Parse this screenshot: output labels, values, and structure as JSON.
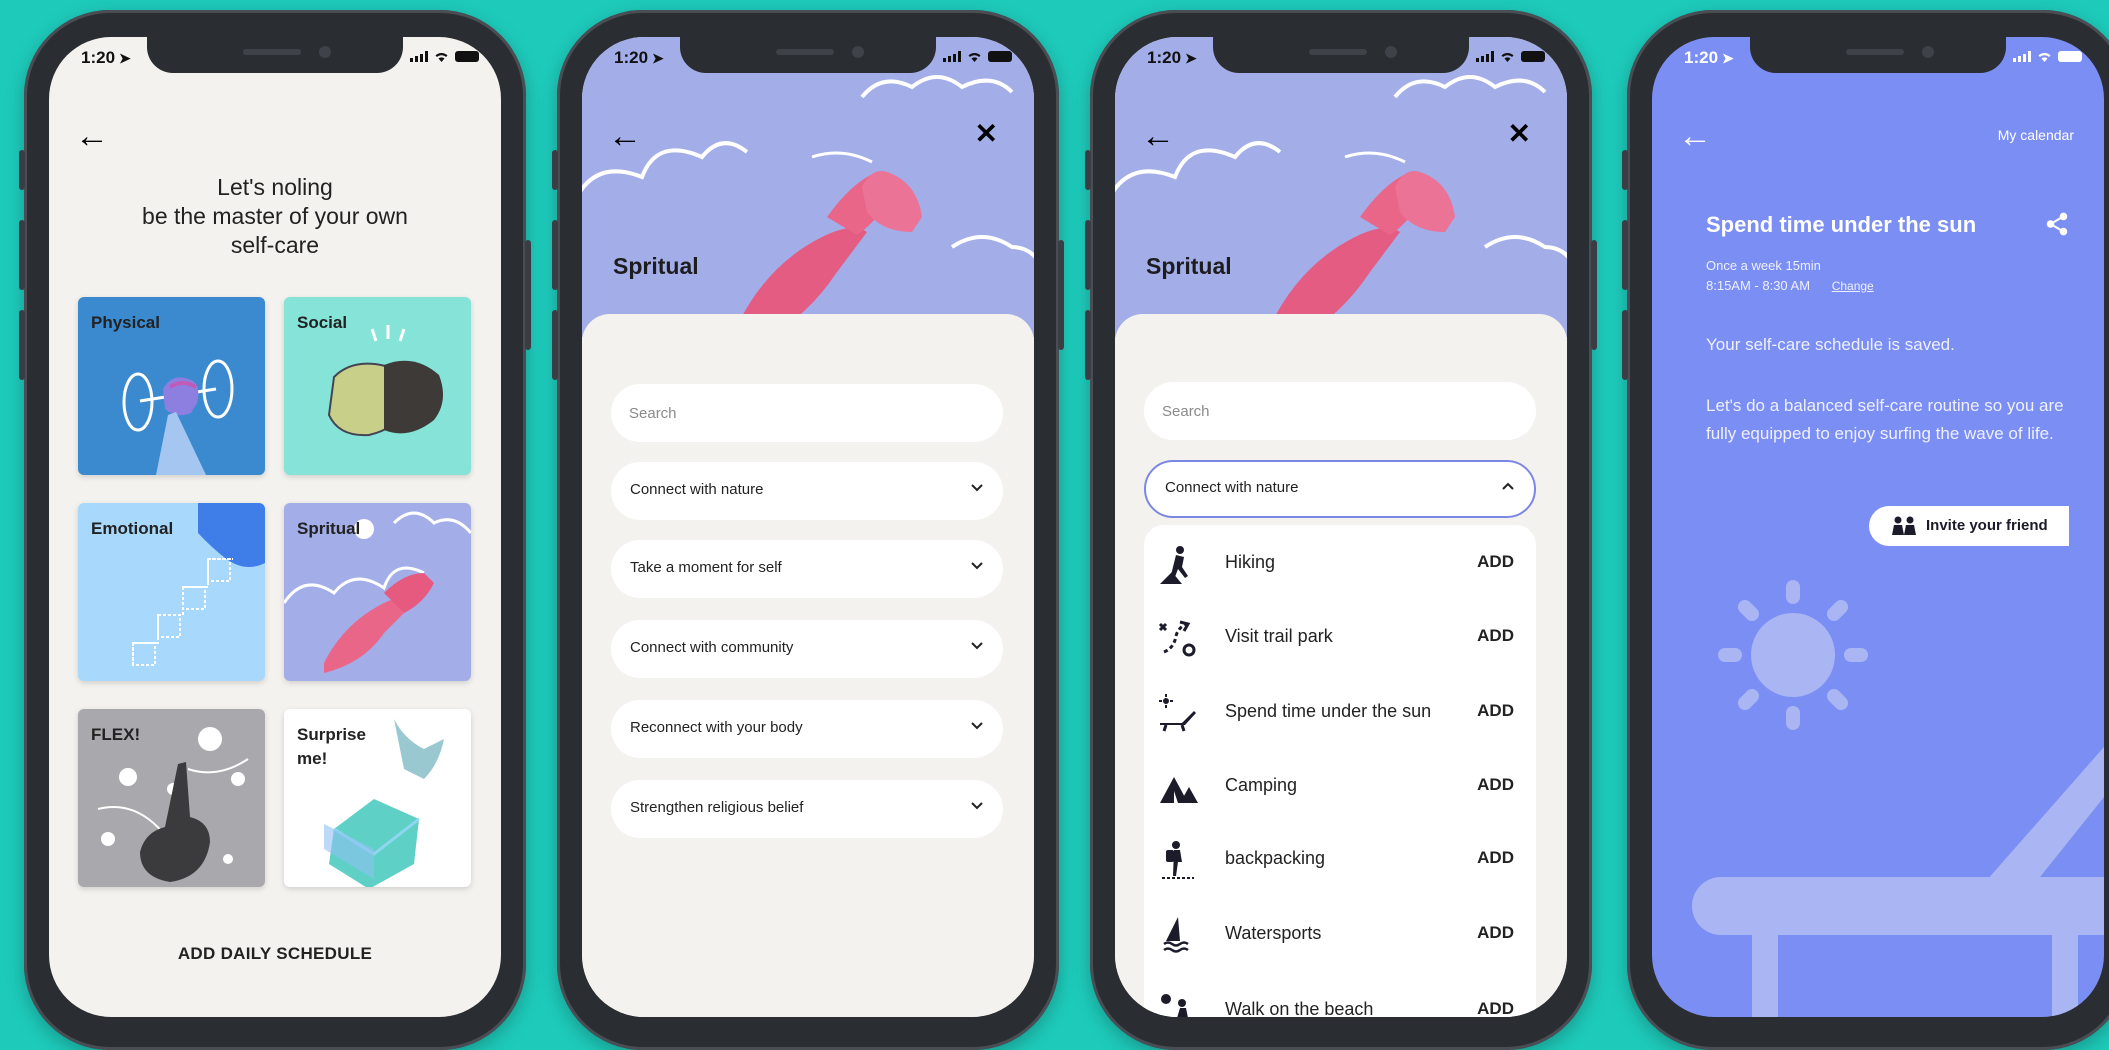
{
  "status": {
    "time": "1:20"
  },
  "screen1": {
    "title_lines": [
      "Let's noling",
      "be the master of your own",
      "self-care"
    ],
    "categories": [
      "Physical",
      "Social",
      "Emotional",
      "Spritual",
      "FLEX!",
      "Surprise me!"
    ],
    "add_schedule": "ADD DAILY SCHEDULE"
  },
  "screen2": {
    "title": "Spritual",
    "search_placeholder": "Search",
    "sections": [
      "Connect with nature",
      "Take a moment for self",
      "Connect with community",
      "Reconnect with your body",
      "Strengthen religious belief"
    ]
  },
  "screen3": {
    "title": "Spritual",
    "search_placeholder": "Search",
    "open_section": "Connect with nature",
    "add_label": "ADD",
    "activities": [
      {
        "name": "Hiking",
        "icon": "hiking-icon"
      },
      {
        "name": "Visit trail park",
        "icon": "trail-icon"
      },
      {
        "name": "Spend time under the sun",
        "icon": "sunbathing-icon"
      },
      {
        "name": "Camping",
        "icon": "tent-icon"
      },
      {
        "name": "backpacking",
        "icon": "backpacker-icon"
      },
      {
        "name": "Watersports",
        "icon": "sailing-icon"
      },
      {
        "name": "Walk on the beach",
        "icon": "beach-walk-icon"
      }
    ]
  },
  "screen4": {
    "calendar_link": "My calendar",
    "title": "Spend time under the sun",
    "frequency": "Once a week 15min",
    "time_range": "8:15AM - 8:30 AM",
    "change": "Change",
    "saved_msg": "Your self-care schedule is saved.",
    "body_msg": "Let's do a balanced self-care routine so you are fully equipped to enjoy surfing the wave of life.",
    "invite": "Invite your friend"
  },
  "colors": {
    "background": "#1ecbbb",
    "accent": "#7b8ef4",
    "hero": "#a3ade8"
  }
}
